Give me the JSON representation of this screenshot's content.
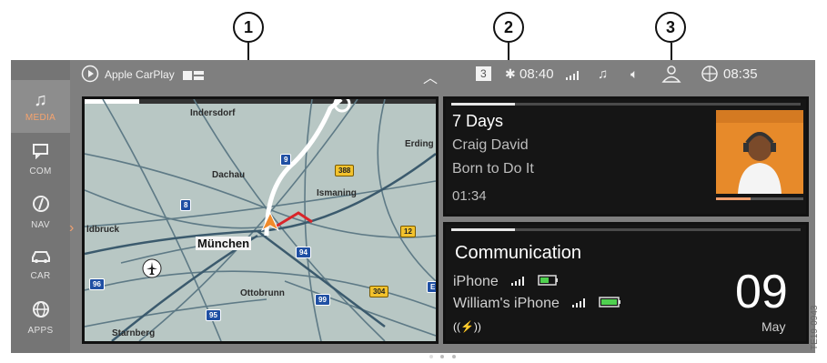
{
  "callouts": [
    "1",
    "2",
    "3"
  ],
  "sidebar": {
    "items": [
      {
        "label": "MEDIA",
        "icon": "music-note-icon",
        "active": true
      },
      {
        "label": "COM",
        "icon": "message-icon",
        "active": false
      },
      {
        "label": "NAV",
        "icon": "compass-icon",
        "active": false
      },
      {
        "label": "CAR",
        "icon": "car-icon",
        "active": false
      },
      {
        "label": "APPS",
        "icon": "apps-globe-icon",
        "active": false
      }
    ]
  },
  "topbar": {
    "carplay_label": "Apple CarPlay",
    "channel_badge": "3",
    "time_left": "08:40",
    "time_right": "08:35"
  },
  "map": {
    "labels": {
      "indersdorf": "Indersdorf",
      "erding": "Erding",
      "dachau": "Dachau",
      "ismaning": "Ismaning",
      "muenchen": "München",
      "fuerstenfeldbruck": "ldbruck",
      "ottobrunn": "Ottobrunn",
      "starnberg": "Starnberg"
    },
    "shields": {
      "s9": "9",
      "s388": "388",
      "s8": "8",
      "s12": "12",
      "s94": "94",
      "s96": "96",
      "s99": "99",
      "s304": "304",
      "s95": "95",
      "sE": "E"
    }
  },
  "media": {
    "title": "7 Days",
    "artist": "Craig David",
    "album": "Born to Do It",
    "elapsed": "01:34",
    "progress": 0.4
  },
  "communication": {
    "heading": "Communication",
    "device1": "iPhone",
    "device2": "William's iPhone",
    "emergency_icon": "((⚡))",
    "day": "09",
    "month": "May"
  },
  "side_code": "TE19-0943",
  "colors": {
    "accent": "#f0a070",
    "route": "#ffffff",
    "route_end": "#d9252a"
  }
}
